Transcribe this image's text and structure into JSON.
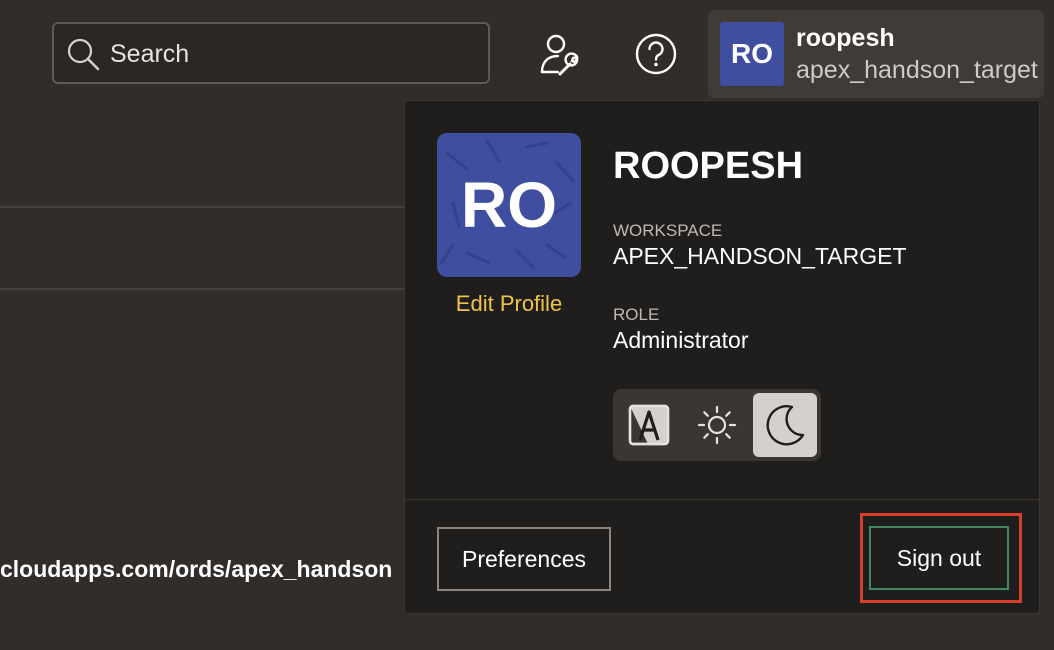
{
  "search": {
    "placeholder": "Search",
    "icon": "search-icon"
  },
  "topbar": {
    "admin_icon": "user-wrench-icon",
    "help_icon": "help-circle-icon"
  },
  "user": {
    "initials": "RO",
    "username": "roopesh",
    "workspace": "apex_handson_target",
    "avatar_color": "#3f4e9f"
  },
  "background": {
    "url_fragment": "cloudapps.com/ords/apex_handson"
  },
  "profile_panel": {
    "initials": "RO",
    "edit_profile": "Edit Profile",
    "display_name": "ROOPESH",
    "workspace_label": "WORKSPACE",
    "workspace_value": "APEX_HANDSON_TARGET",
    "role_label": "ROLE",
    "role_value": "Administrator",
    "theme_options": [
      {
        "icon": "auto-theme-icon",
        "selected": false
      },
      {
        "icon": "sun-icon",
        "selected": false
      },
      {
        "icon": "moon-icon",
        "selected": true
      }
    ],
    "preferences_label": "Preferences",
    "signout_label": "Sign out"
  },
  "colors": {
    "accent_link": "#f0c44c",
    "highlight": "#d7412c",
    "signout_border": "#3f8a5e"
  }
}
